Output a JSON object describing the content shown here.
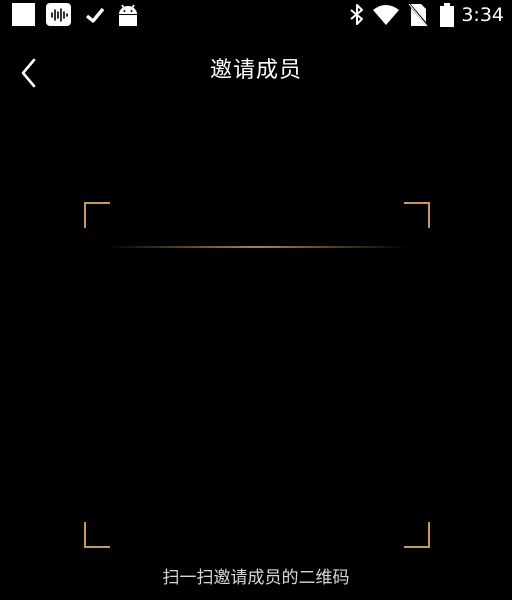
{
  "status_bar": {
    "time": "3:34",
    "left_icons": [
      "notification-square-icon",
      "voicemail-icon",
      "check-icon",
      "android-icon"
    ],
    "right_icons": [
      "bluetooth-icon",
      "wifi-icon",
      "no-sim-icon",
      "battery-icon"
    ]
  },
  "header": {
    "title": "邀请成员",
    "back_icon": "chevron-left-icon"
  },
  "scanner": {
    "hint": "扫一扫邀请成员的二维码",
    "accent_color": "#c99a56"
  },
  "colors": {
    "background": "#000000",
    "text": "#ffffff",
    "hint_text": "#d8d8d8"
  }
}
